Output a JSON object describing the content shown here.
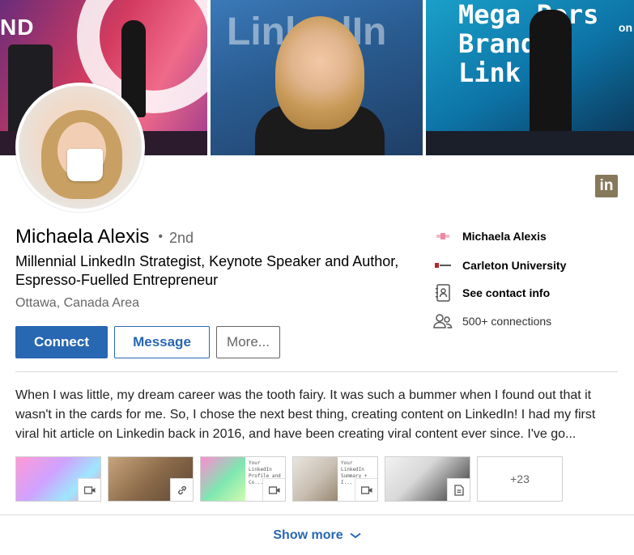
{
  "banner": {
    "photo1_text": "ND",
    "photo2_text": "LinkedIn",
    "photo3_text_lines": [
      "Mega Pers",
      "Brand n",
      "Link"
    ],
    "photo3_text_side": "on"
  },
  "profile": {
    "name": "Michaela Alexis",
    "degree_separator": "•",
    "degree": "2nd",
    "headline": "Millennial LinkedIn Strategist, Keynote Speaker and Author, Espresso-Fuelled Entrepreneur",
    "location": "Ottawa, Canada Area"
  },
  "badge": {
    "label": "in",
    "icon": "linkedin-icon"
  },
  "actions": {
    "connect_label": "Connect",
    "message_label": "Message",
    "more_label": "More..."
  },
  "side": {
    "company": "Michaela Alexis",
    "school": "Carleton University",
    "contact": "See contact info",
    "connections": "500+ connections"
  },
  "summary": {
    "text": "When I was little, my dream career was the tooth fairy. It was such a bummer when I found out that it wasn't in the cards for me. So, I chose the next best thing, creating content on LinkedIn! I had my first viral hit article on Linkedin back in 2016, and have been creating viral content ever since. I've go..."
  },
  "media": {
    "tiles": [
      {
        "kind": "video-icon"
      },
      {
        "kind": "link-icon"
      },
      {
        "kind": "video-icon",
        "doc_text": "Your LinkedIn Profile and Co... Ph..."
      },
      {
        "kind": "video-icon",
        "doc_text": "Your LinkedIn Summary + I... Tip..."
      },
      {
        "kind": "document-icon"
      }
    ],
    "more_label": "+23"
  },
  "footer": {
    "show_more_label": "Show more"
  },
  "colors": {
    "accent": "#2867b2",
    "badge": "#86785a"
  }
}
